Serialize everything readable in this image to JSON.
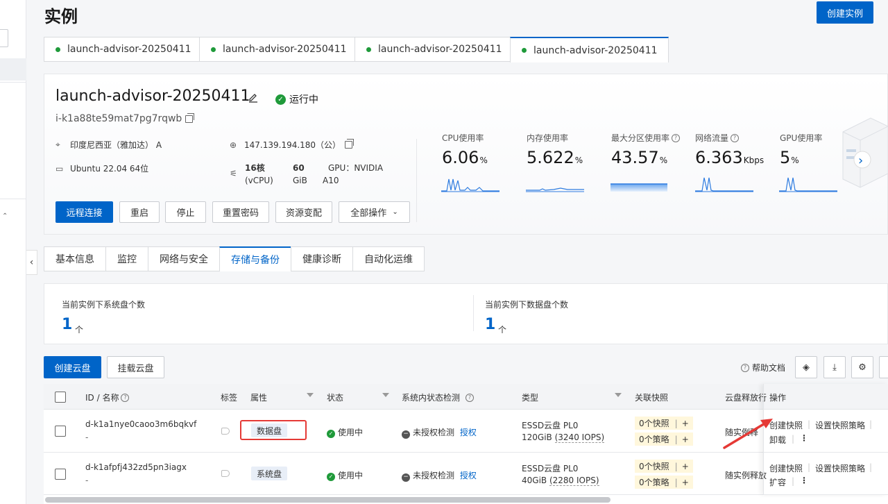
{
  "page": {
    "title": "实例",
    "create_button": "创建实例"
  },
  "instance_tabs": [
    "launch-advisor-20250411",
    "launch-advisor-20250411",
    "launch-advisor-20250411",
    "launch-advisor-20250411"
  ],
  "instance": {
    "name": "launch-advisor-20250411",
    "status": "运行中",
    "id": "i-k1a88te59mat7pg7rqwb",
    "region": "印度尼西亚（雅加达） A",
    "ip": "147.139.194.180（公）",
    "os": "Ubuntu 22.04 64位",
    "cpu_line1": "16核",
    "cpu_line2": "(vCPU)",
    "mem_line1": "60",
    "mem_line2": "GiB",
    "gpu_line1": "GPU：NVIDIA",
    "gpu_line2": "A10"
  },
  "actions": {
    "remote": "远程连接",
    "restart": "重启",
    "stop": "停止",
    "reset_pwd": "重置密码",
    "resize": "资源变配",
    "all_ops": "全部操作"
  },
  "metrics": [
    {
      "label": "CPU使用率",
      "value": "6.06",
      "unit": "%"
    },
    {
      "label": "内存使用率",
      "value": "5.622",
      "unit": "%"
    },
    {
      "label": "最大分区使用率",
      "value": "43.57",
      "unit": "%"
    },
    {
      "label": "网络流量",
      "value": "6.363",
      "unit": "Kbps"
    },
    {
      "label": "GPU使用率",
      "value": "5",
      "unit": "%"
    }
  ],
  "detail_tabs": [
    "基本信息",
    "监控",
    "网络与安全",
    "存储与备份",
    "健康诊断",
    "自动化运维"
  ],
  "summary": {
    "sys_label": "当前实例下系统盘个数",
    "sys_value": "1",
    "sys_unit": "个",
    "data_label": "当前实例下数据盘个数",
    "data_value": "1",
    "data_unit": "个"
  },
  "toolbar": {
    "create_disk": "创建云盘",
    "attach_disk": "挂载云盘",
    "help": "帮助文档"
  },
  "table": {
    "headers": {
      "id": "ID / 名称",
      "tag": "标签",
      "attr": "属性",
      "status": "状态",
      "check": "系统内状态检测",
      "type": "类型",
      "snap": "关联快照",
      "release": "云盘释放行",
      "ops": "操作"
    },
    "rows": [
      {
        "id": "d-k1a1nye0caoo3m6bqkvf",
        "name": "-",
        "attr": "数据盘",
        "status": "使用中",
        "check": "未授权检测",
        "check_link": "授权",
        "type1": "ESSD云盘  PL0",
        "type2a": "120GiB",
        "type2b": "(3240 IOPS)",
        "snap1": "0个快照",
        "snap2": "0个策略",
        "release": "随实例释",
        "op1": "创建快照",
        "op2": "设置快照策略",
        "op3": "卸载"
      },
      {
        "id": "d-k1afpfj432zd5pn3iagx",
        "name": "-",
        "attr": "系统盘",
        "status": "使用中",
        "check": "未授权检测",
        "check_link": "授权",
        "type1": "ESSD云盘  PL0",
        "type2a": "40GiB",
        "type2b": "(2280 IOPS)",
        "snap1": "0个快照",
        "snap2": "0个策略",
        "release": "随实例释放",
        "op1": "创建快照",
        "op2": "设置快照策略",
        "op3": "扩容"
      }
    ]
  },
  "colors": {
    "primary": "#0064c8",
    "success": "#1f9a3a",
    "highlight": "#e53935"
  }
}
